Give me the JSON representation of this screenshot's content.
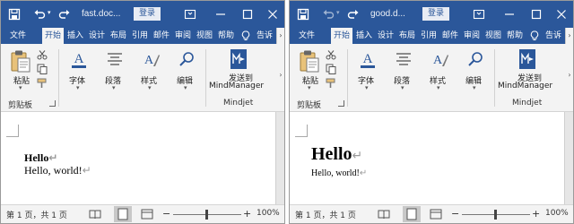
{
  "windows": [
    {
      "quick_access": {
        "save_icon": "save-icon",
        "undo_icon": "undo-icon",
        "redo_icon": "redo-icon"
      },
      "doc_title": "fast.doc...",
      "login_label": "登录",
      "tabs": [
        "文件",
        "开始",
        "插入",
        "设计",
        "布局",
        "引用",
        "邮件",
        "审阅",
        "视图",
        "帮助",
        "告诉"
      ],
      "active_tab": "开始",
      "ribbon": {
        "paste_label": "粘贴",
        "clipboard_group": "剪贴板",
        "font_label": "字体",
        "paragraph_label": "段落",
        "styles_label": "样式",
        "editing_label": "编辑",
        "send_to_line1": "发送到",
        "send_to_line2": "MindManager",
        "mindjet_group": "Mindjet"
      },
      "document": {
        "line1": "Hello",
        "line2": "Hello, world!"
      },
      "status": {
        "page_info": "第 1 页，共 1 页",
        "zoom_level": "100%"
      }
    },
    {
      "quick_access": {
        "save_icon": "save-icon",
        "undo_icon": "undo-icon",
        "redo_icon": "redo-icon"
      },
      "doc_title": "good.d...",
      "login_label": "登录",
      "tabs": [
        "文件",
        "开始",
        "插入",
        "设计",
        "布局",
        "引用",
        "邮件",
        "审阅",
        "视图",
        "帮助",
        "告诉"
      ],
      "active_tab": "开始",
      "ribbon": {
        "paste_label": "粘贴",
        "clipboard_group": "剪贴板",
        "font_label": "字体",
        "paragraph_label": "段落",
        "styles_label": "样式",
        "editing_label": "编辑",
        "send_to_line1": "发送到",
        "send_to_line2": "MindManager",
        "mindjet_group": "Mindjet"
      },
      "document": {
        "line1": "Hello",
        "line2": "Hello, world!"
      },
      "status": {
        "page_info": "第 1 页，共 1 页",
        "zoom_level": "100%"
      }
    }
  ],
  "colors": {
    "title_bar": "#2b579a",
    "ribbon_bg": "#f3f3f3",
    "status_bg": "#f3f3f3"
  }
}
